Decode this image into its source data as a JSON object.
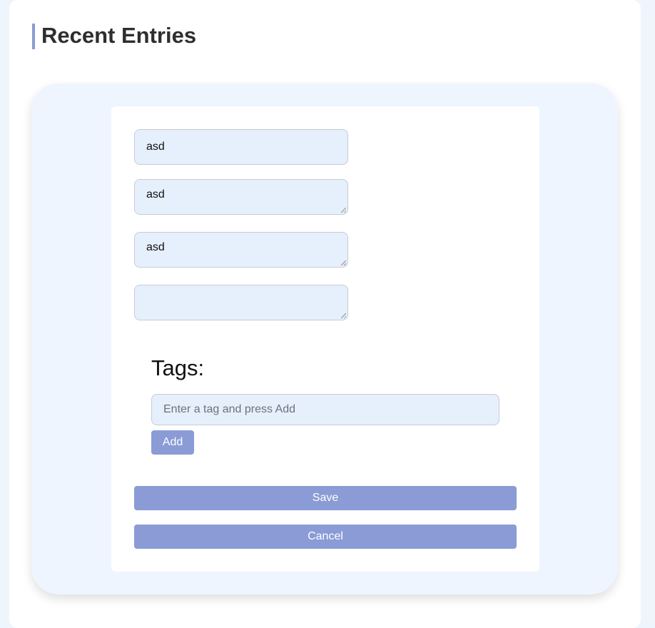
{
  "page": {
    "title": "Recent Entries"
  },
  "form": {
    "fields": [
      {
        "value": "asd"
      },
      {
        "value": "asd"
      },
      {
        "value": "asd"
      },
      {
        "value": ""
      }
    ],
    "tags": {
      "heading": "Tags:",
      "input_placeholder": "Enter a tag and press Add",
      "add_label": "Add"
    },
    "save_label": "Save",
    "cancel_label": "Cancel"
  },
  "colors": {
    "accent": "#8a9bd6",
    "input_bg": "#e6effc",
    "panel_bg": "#eef5fe",
    "page_bg": "#eef5fd"
  }
}
